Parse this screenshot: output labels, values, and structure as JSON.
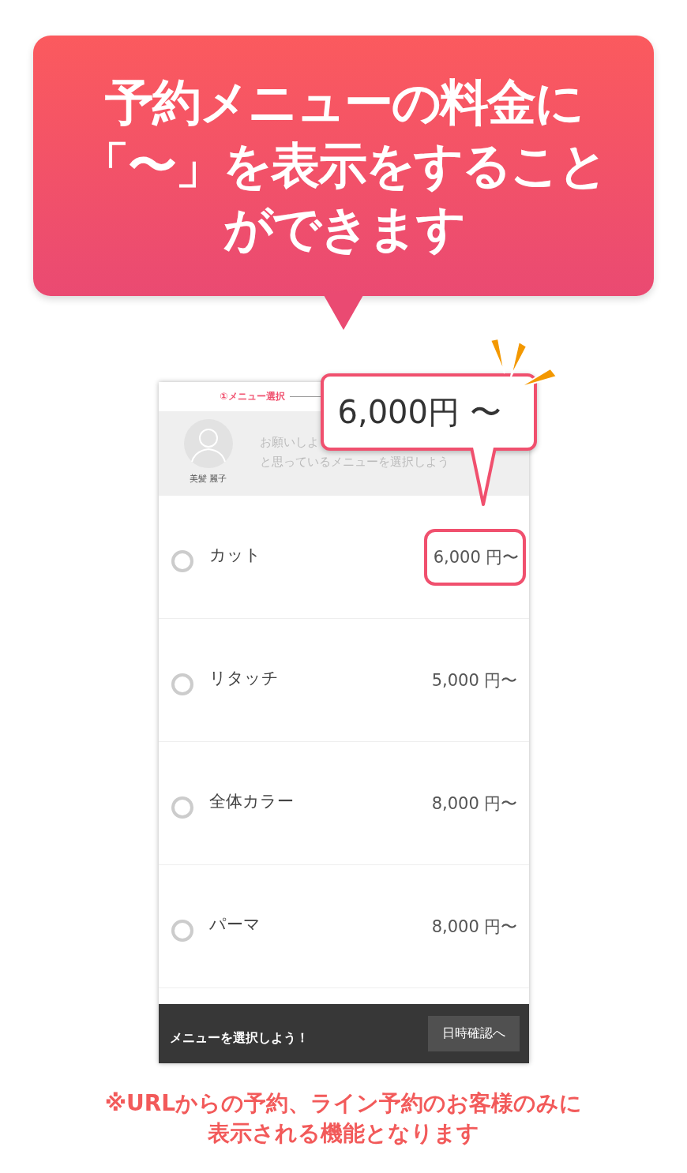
{
  "headline": {
    "lines": [
      "予約メニューの料金に",
      "「〜」を表示をすること",
      "ができます"
    ]
  },
  "phone": {
    "step": "①メニュー選択",
    "stylist": {
      "name": "美髪 麗子",
      "message_lines": [
        "お願いしよ",
        "と思っているメニューを選択しよう"
      ]
    },
    "menu": [
      {
        "name": "カット",
        "price": "6,000 円〜",
        "selected": false,
        "highlighted": true
      },
      {
        "name": "リタッチ",
        "price": "5,000 円〜",
        "selected": false,
        "highlighted": false
      },
      {
        "name": "全体カラー",
        "price": "8,000 円〜",
        "selected": false,
        "highlighted": false
      },
      {
        "name": "パーマ",
        "price": "8,000 円〜",
        "selected": false,
        "highlighted": false
      }
    ],
    "bottom_bar": {
      "prompt": "メニューを選択しよう！",
      "button": "日時確認へ"
    }
  },
  "callout": {
    "text": "6,000円 〜"
  },
  "footnote": {
    "lines": [
      "※URLからの予約、ライン予約のお客様のみに",
      "表示される機能となります"
    ]
  }
}
